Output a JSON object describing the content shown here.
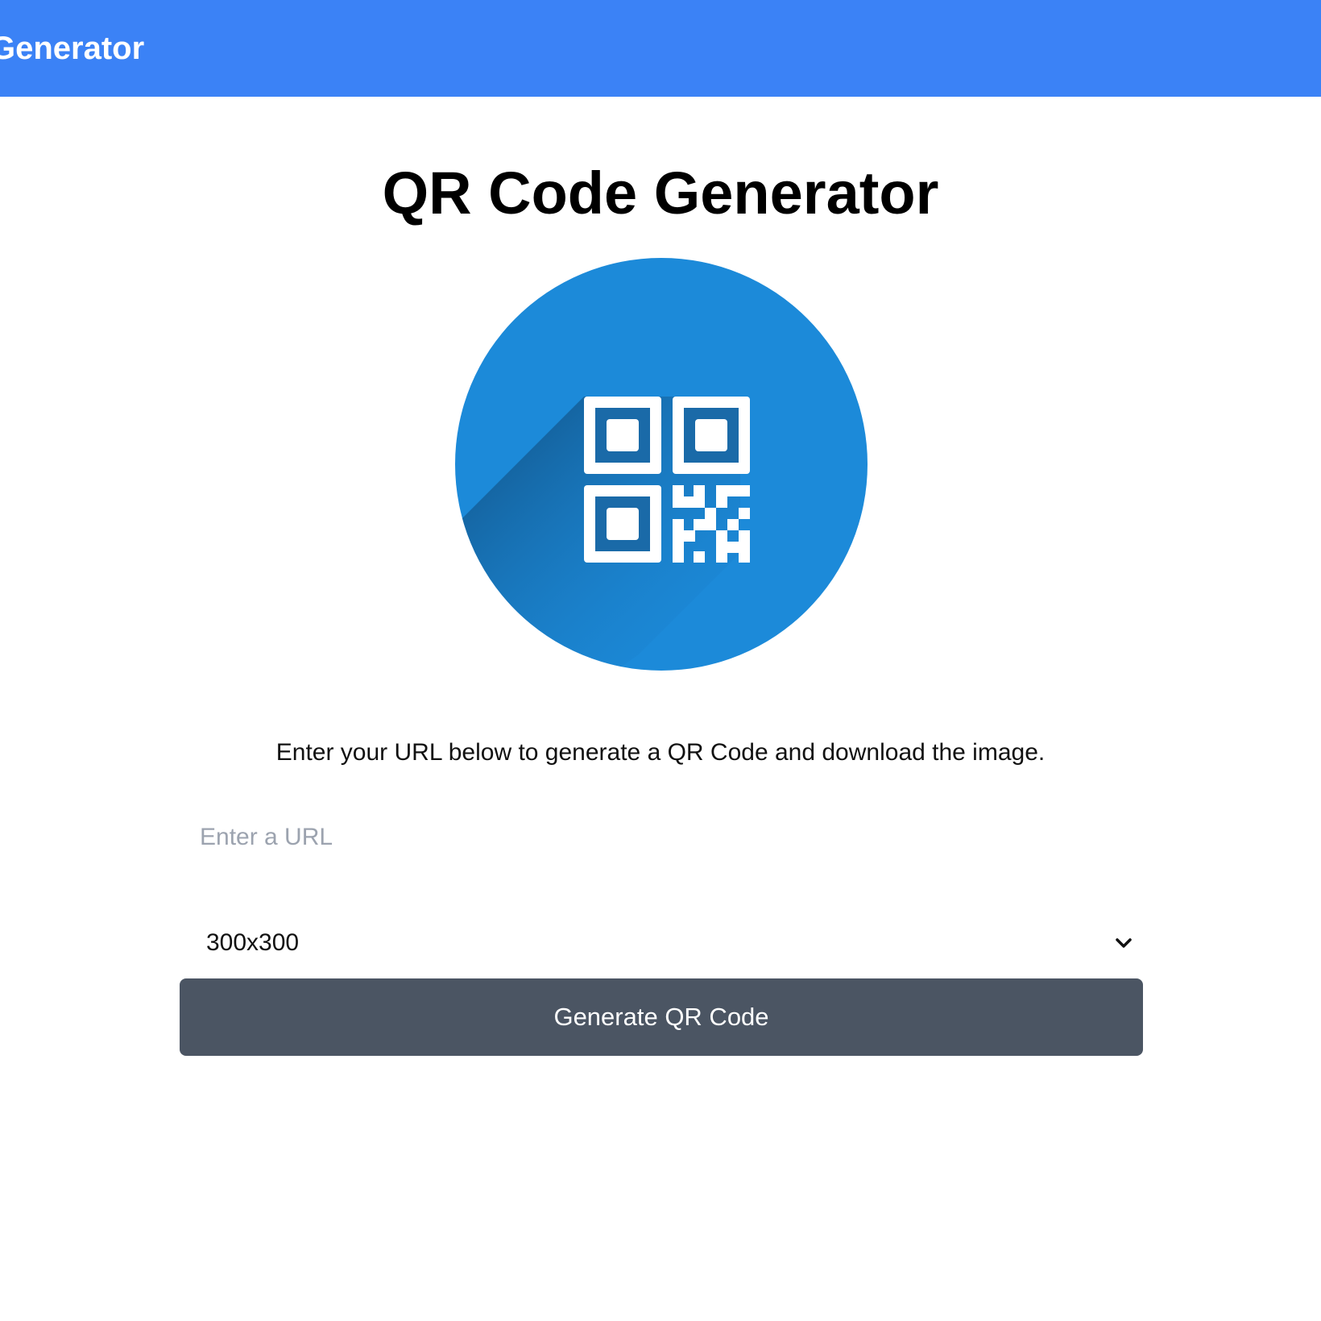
{
  "header": {
    "title": "Generator",
    "background_color": "#3b82f6"
  },
  "main": {
    "title": "QR Code Generator",
    "hero_icon": "qr-code-icon",
    "description": "Enter your URL below to generate a QR Code and download the image.",
    "url_input": {
      "value": "",
      "placeholder": "Enter a URL"
    },
    "size_select": {
      "selected": "300x300"
    },
    "generate_button_label": "Generate QR Code",
    "button_color": "#4b5563",
    "icon_circle_color": "#1c8ad9"
  }
}
